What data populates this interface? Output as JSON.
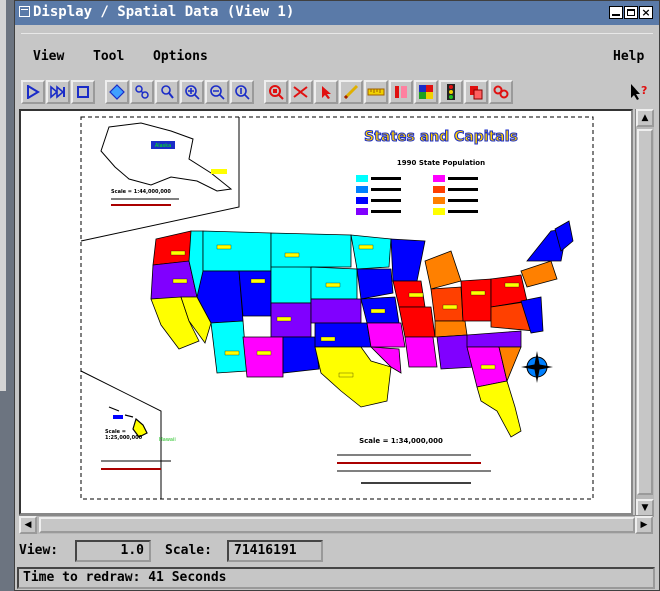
{
  "window": {
    "title": "Display / Spatial Data (View 1)"
  },
  "menu": {
    "view": "View",
    "tool": "Tool",
    "options": "Options",
    "help": "Help"
  },
  "toolbar": {
    "icons": [
      "play-icon",
      "step-icon",
      "stop-icon",
      "diamond-icon",
      "pan-icon",
      "zoom-box-icon",
      "zoom-in-icon",
      "zoom-out-icon",
      "zoom-full-icon",
      "zoom-red-icon",
      "select-red-icon",
      "pointer-icon",
      "sketch-icon",
      "measure-icon",
      "legend-icon",
      "layers-icon",
      "traffic-light-icon",
      "copy-icon",
      "link-icon",
      "help-pointer-icon"
    ]
  },
  "map": {
    "title": "States and Capitals",
    "subtitle": "1990 State Population",
    "legend_colors": [
      "#00ffff",
      "#0080ff",
      "#0000ff",
      "#8000ff",
      "#ff00ff",
      "#ff4000",
      "#ff8000",
      "#ffff00"
    ],
    "alaska_label": "Alaska",
    "hawaii_label": "Hawaii",
    "scale_text": "Scale = 1:34,000,000",
    "alaska_scale": "Scale = 1:44,000,000",
    "hawaii_scale_a": "Scale =",
    "hawaii_scale_b": "1:25,000,000"
  },
  "status": {
    "view_label": "View:",
    "view_value": "1.0",
    "scale_label": "Scale:",
    "scale_value": "71416191",
    "redraw": "Time to redraw: 41 Seconds"
  }
}
